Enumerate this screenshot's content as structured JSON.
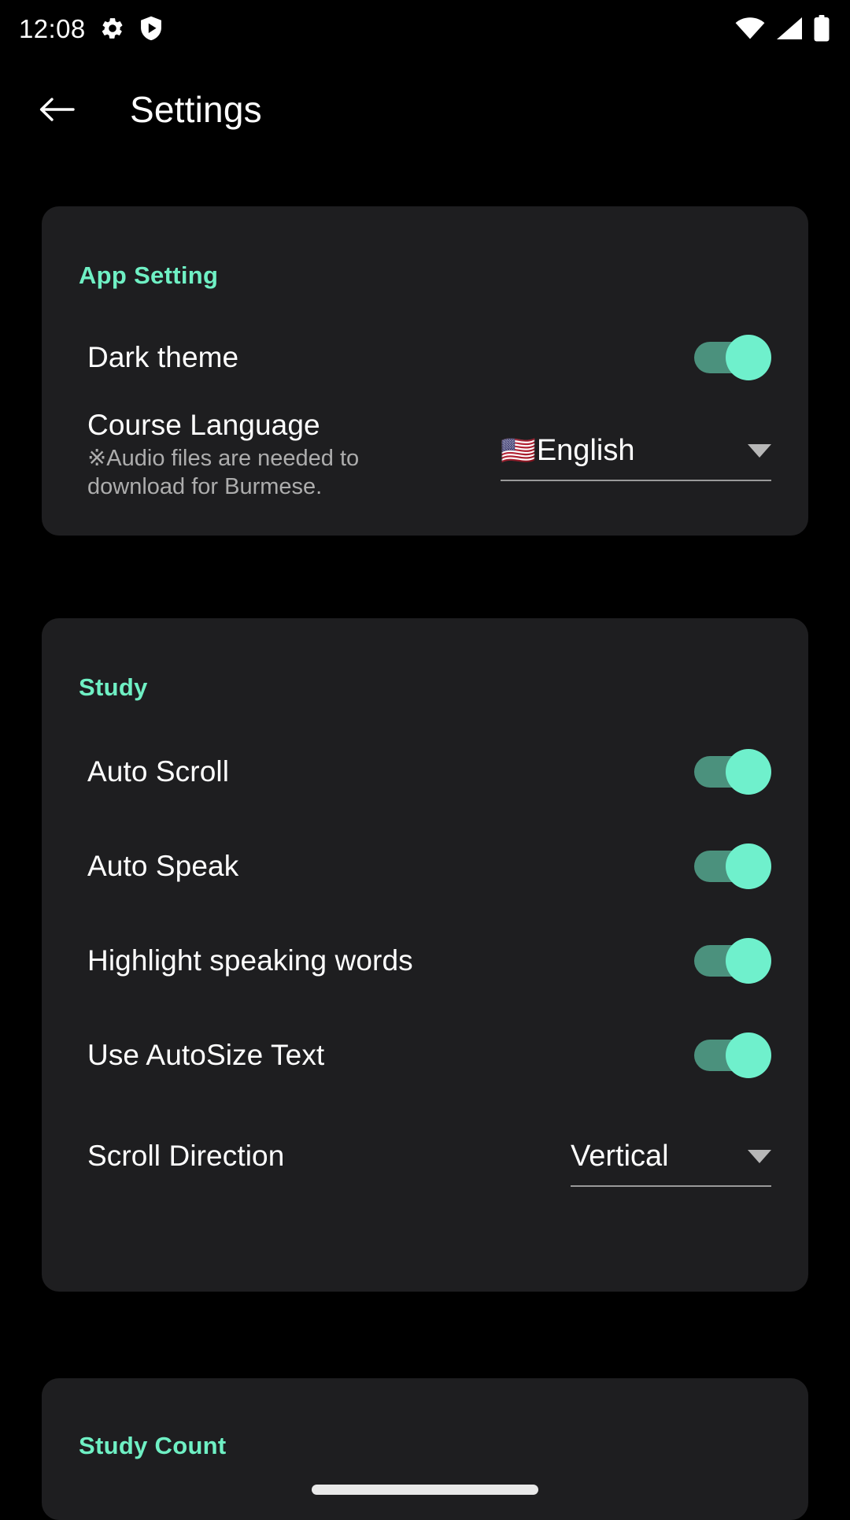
{
  "status_bar": {
    "time": "12:08",
    "left_icons": [
      "gear-icon",
      "shield-play-icon"
    ],
    "right_icons": [
      "wifi-icon",
      "cellular-signal-icon",
      "battery-icon"
    ]
  },
  "app_bar": {
    "back_icon": "arrow-left-icon",
    "title": "Settings"
  },
  "colors": {
    "accent": "#6ff0c4",
    "switch_track_on": "#4b917d",
    "switch_thumb_on": "#6ff0cc",
    "card_background": "#1e1e20",
    "page_background": "#000000",
    "primary_text": "#ffffff",
    "secondary_text": "#adadad"
  },
  "sections": [
    {
      "title": "App Setting",
      "rows": [
        {
          "label": "Dark theme",
          "control": "switch",
          "value": "on"
        },
        {
          "label": "Course Language",
          "sublabel": "※Audio files are needed to download for Burmese.",
          "control": "dropdown",
          "flag": "🇺🇸",
          "value": "English"
        }
      ]
    },
    {
      "title": "Study",
      "rows": [
        {
          "label": "Auto Scroll",
          "control": "switch",
          "value": "on"
        },
        {
          "label": "Auto Speak",
          "control": "switch",
          "value": "on"
        },
        {
          "label": "Highlight speaking words",
          "control": "switch",
          "value": "on"
        },
        {
          "label": "Use AutoSize Text",
          "control": "switch",
          "value": "on"
        },
        {
          "label": "Scroll Direction",
          "control": "dropdown",
          "value": "Vertical"
        }
      ]
    },
    {
      "title": "Study Count",
      "rows": []
    }
  ]
}
